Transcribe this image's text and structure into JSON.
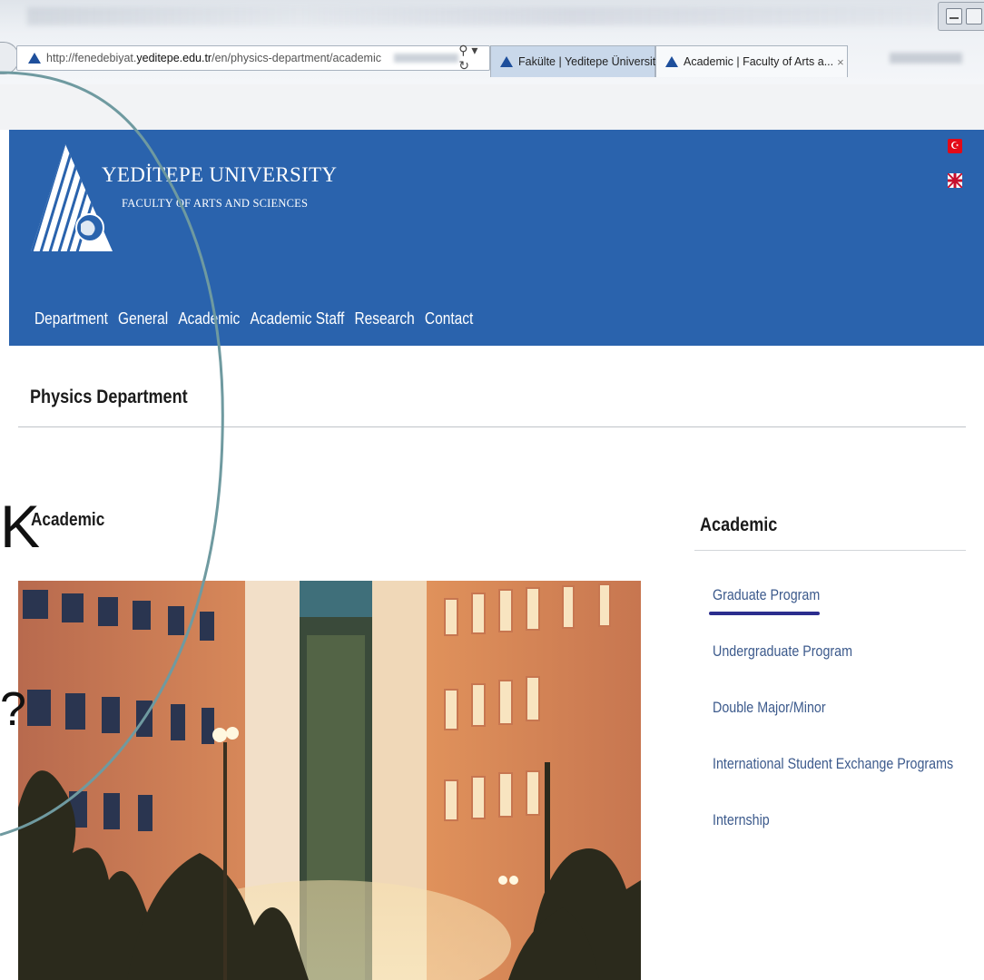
{
  "browser": {
    "url_prefix": "http://fenedebiyat.",
    "url_domain": "yeditepe.edu.tr",
    "url_path": "/en/physics-department/academic",
    "search_glyph": "⚲ ▾ ↻",
    "tabs": [
      {
        "label": "Fakülte | Yeditepe Üniversitesi"
      },
      {
        "label": "Academic | Faculty of Arts a...",
        "close": "×"
      }
    ]
  },
  "header": {
    "university": "YEDİTEPE UNIVERSITY",
    "faculty": "FACULTY OF ARTS AND SCIENCES",
    "flag_tr_glyph": "☪"
  },
  "nav": {
    "items": [
      {
        "label": "Department"
      },
      {
        "label": "General"
      },
      {
        "label": "Academic"
      },
      {
        "label": "Academic Staff"
      },
      {
        "label": "Research"
      },
      {
        "label": "Contact"
      }
    ]
  },
  "page": {
    "department": "Physics Department",
    "content_title": "Academic"
  },
  "sidebar": {
    "title": "Academic",
    "links": [
      {
        "label": "Graduate Program"
      },
      {
        "label": "Undergraduate Program"
      },
      {
        "label": "Double Major/Minor"
      },
      {
        "label": "International Student Exchange Programs"
      },
      {
        "label": "Internship"
      }
    ]
  },
  "overlay": {
    "glyph_1": "K",
    "glyph_2": "?"
  },
  "colors": {
    "banner": "#2a63ad",
    "active_underline": "#2b2d8e",
    "sidebar_link": "#3c5a8c",
    "annotation_circle": "#6f9aa0"
  }
}
